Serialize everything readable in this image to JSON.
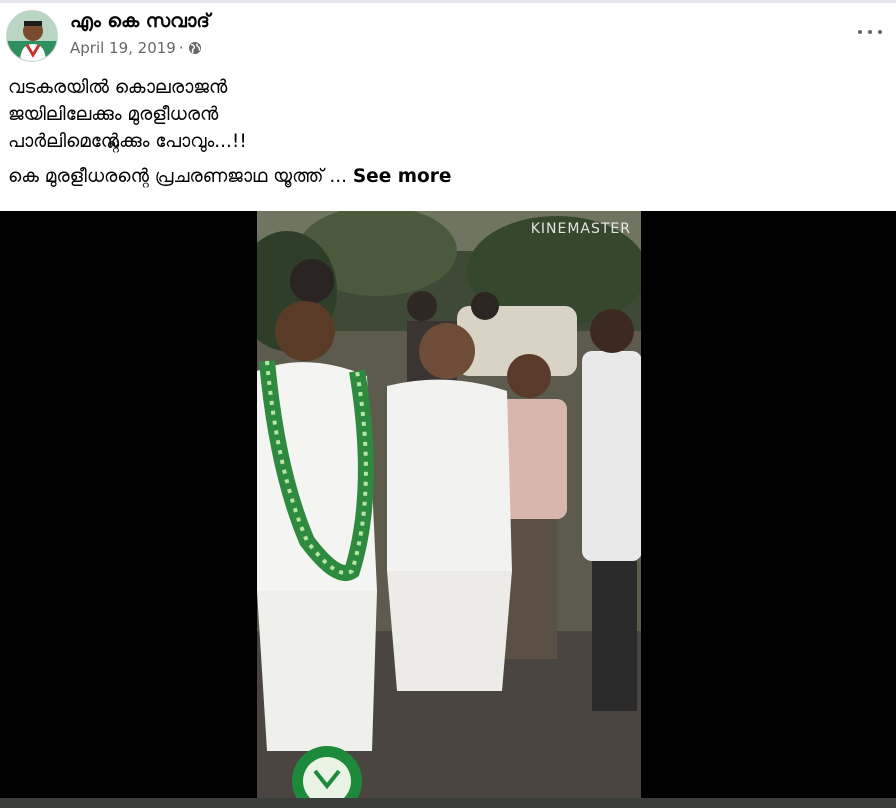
{
  "post": {
    "author": "എം കെ സവാദ്",
    "date": "April 19, 2019",
    "separator": "·",
    "privacy_icon": "globe-icon",
    "more_icon": "more-options-icon",
    "text_lines": [
      "വടകരയിൽ കൊലരാജൻ",
      "ജയിലിലേക്കും മുരളീധരൻ",
      "പാർലിമെന്റ്ലേക്കും പോവും...!!"
    ],
    "text_last": "കെ മുരളീധരന്റെ പ്രചരണജാഥ യൂത്ത് ...",
    "see_more": "See more"
  },
  "video": {
    "watermark": "KINEMASTER"
  },
  "colors": {
    "text": "#050505",
    "secondary": "#65676b",
    "media_bg": "#000000"
  }
}
